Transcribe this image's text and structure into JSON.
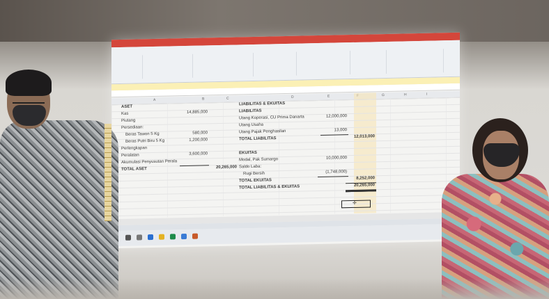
{
  "spreadsheet": {
    "left": {
      "aset": "ASET",
      "kas": "Kas",
      "kas_value": "14,885,000",
      "piutang": "Piutang",
      "persediaan": "Persediaan:",
      "beras_tawon": "Beras Tawon 5 Kg",
      "beras_tawon_value": "580,000",
      "beras_putri": "Beras Putri Biru 5 Kg",
      "beras_putri_value": "1,200,000",
      "perlengkapan": "Perlengkapan",
      "peralatan": "Peralatan",
      "peralatan_value": "3,600,000",
      "akumulasi": "Akumulasi Penyusutan Perala",
      "total_aset": "TOTAL ASET",
      "total_aset_value": "20,265,000"
    },
    "right": {
      "header": "LIABILITAS & EKUITAS",
      "liabilitas": "LIABILITAS",
      "utang_koperasi": "Utang Koperasi, CU Prima Danarta",
      "utang_koperasi_value": "12,000,000",
      "utang_usaha": "Utang Usaha",
      "utang_pajak": "Utang Pajak Penghasilan",
      "utang_pajak_value": "13,000",
      "total_liabilitas": "TOTAL LIABILITAS",
      "total_liabilitas_value": "12,013,000",
      "ekuitas": "EKUITAS",
      "modal": "Modal, Pak Sumargo",
      "modal_value": "10,000,000",
      "saldo_laba": "Saldo Laba:",
      "rugi_bersih": "Rugi Bersih",
      "rugi_bersih_value": "(1,748,000)",
      "total_ekuitas": "TOTAL EKUITAS",
      "total_ekuitas_value": "8,252,000",
      "total_le": "TOTAL LIABILITAS & EKUITAS",
      "total_le_value": "20,265,000"
    },
    "columns": [
      "A",
      "B",
      "C",
      "D",
      "E",
      "F",
      "G",
      "H",
      "I"
    ]
  },
  "colors": {
    "excel_title": "#d4463b",
    "highlight_col": "#f7e3b0"
  }
}
